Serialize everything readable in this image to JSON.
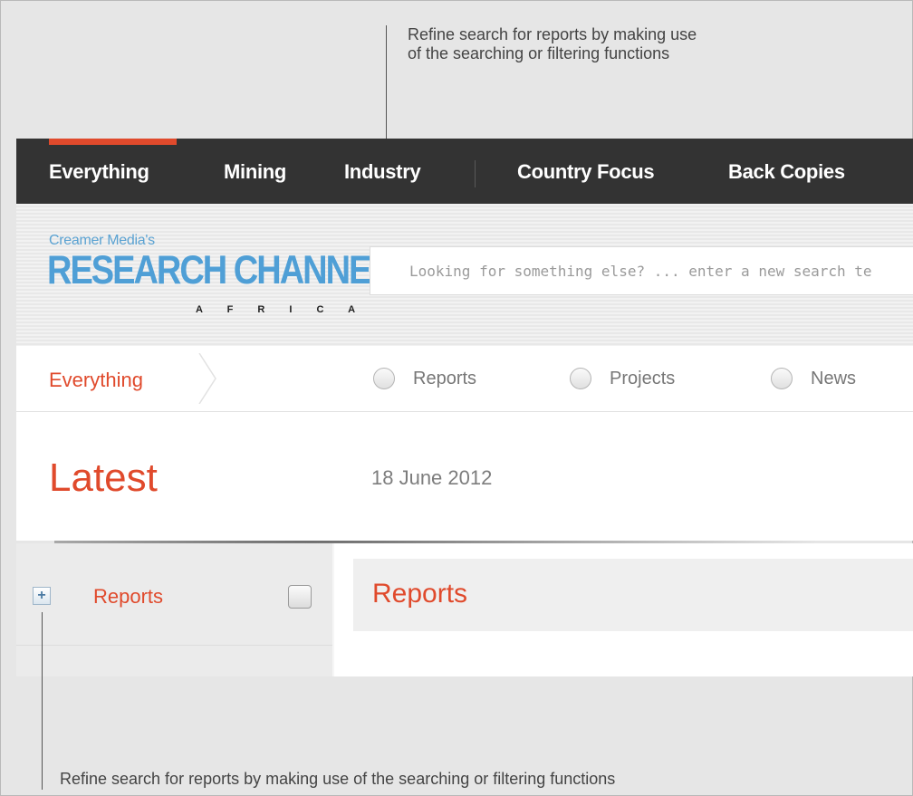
{
  "annotations": {
    "top": "Refine search for reports by making use\nof the searching or filtering functions",
    "top_line1": "Refine search for reports by making use",
    "top_line2": "of the searching or filtering functions",
    "bottom": "Refine search for reports by making use of the searching or filtering functions"
  },
  "nav": {
    "items": [
      "Everything",
      "Mining",
      "Industry",
      "Country Focus",
      "Back Copies"
    ],
    "active": "Everything",
    "active_color": "#e04a2c"
  },
  "logo": {
    "small": "Creamer Media's",
    "main": "RESEARCH CHANNEL",
    "sub": "A F R I C A"
  },
  "search": {
    "placeholder": "Looking for something else? ... enter a new search te"
  },
  "filter": {
    "breadcrumb": "Everything",
    "options": [
      "Reports",
      "Projects",
      "News"
    ]
  },
  "latest": {
    "title": "Latest",
    "date": "18 June 2012"
  },
  "sidebar": {
    "expand_symbol": "+",
    "label": "Reports"
  },
  "main": {
    "title": "Reports"
  },
  "colors": {
    "accent": "#e04a2c",
    "nav_bg": "#333333",
    "logo_blue": "#4f9fd6"
  }
}
